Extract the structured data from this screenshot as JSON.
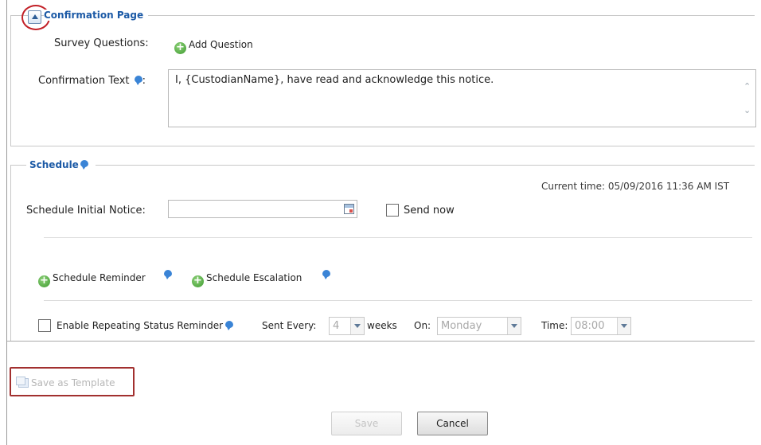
{
  "confirmation": {
    "legend": "Confirmation Page",
    "survey_label": "Survey Questions:",
    "add_question": "Add Question",
    "confirmation_text_label": "Confirmation Text",
    "label_colon": ":",
    "confirmation_text_value": "I, {CustodianName}, have read and acknowledge this notice."
  },
  "schedule": {
    "legend": "Schedule",
    "current_time": "Current time: 05/09/2016 11:36 AM IST",
    "initial_notice_label": "Schedule Initial Notice:",
    "initial_notice_value": "",
    "send_now": "Send now",
    "schedule_reminder": "Schedule Reminder",
    "schedule_escalation": "Schedule Escalation",
    "enable_repeating": "Enable Repeating Status Reminder",
    "sent_every_label": "Sent Every:",
    "sent_every_value": "4",
    "weeks": "weeks",
    "on_label": "On:",
    "on_value": "Monday",
    "time_label": "Time:",
    "time_value": "08:00"
  },
  "footer": {
    "save_as_template": "Save as Template",
    "save": "Save",
    "cancel": "Cancel"
  },
  "colors": {
    "legend": "#1c5aa6",
    "highlight": "#a2302f",
    "accent_green": "#3d9a2f"
  }
}
